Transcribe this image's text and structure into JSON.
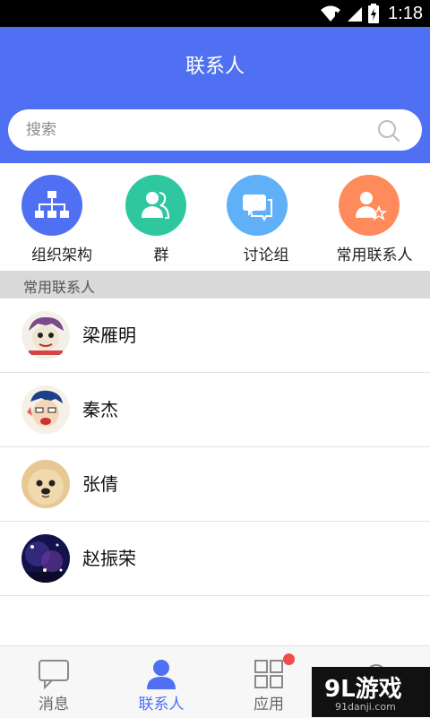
{
  "status_bar": {
    "time": "1:18"
  },
  "header": {
    "title": "联系人"
  },
  "search": {
    "placeholder": "搜索"
  },
  "quick_actions": [
    {
      "label": "组织架构",
      "icon": "org-chart-icon",
      "color": "#4f70f2"
    },
    {
      "label": "群",
      "icon": "group-icon",
      "color": "#2fc7a0"
    },
    {
      "label": "讨论组",
      "icon": "discussion-icon",
      "color": "#5fb0f7"
    },
    {
      "label": "常用联系人",
      "icon": "favorite-contact-icon",
      "color": "#ff8a5b"
    }
  ],
  "section": {
    "title": "常用联系人"
  },
  "contacts": [
    {
      "name": "梁雁明"
    },
    {
      "name": "秦杰"
    },
    {
      "name": "张倩"
    },
    {
      "name": "赵振荣"
    }
  ],
  "bottom_nav": [
    {
      "label": "消息",
      "icon": "chat-bubble-icon"
    },
    {
      "label": "联系人",
      "icon": "person-icon",
      "active": true
    },
    {
      "label": "应用",
      "icon": "apps-grid-icon",
      "badge": true
    },
    {
      "label": "",
      "icon": "settings-icon"
    }
  ],
  "watermark": {
    "main": "9L游戏",
    "sub": "91danji.com"
  },
  "colors": {
    "primary": "#4f70f2",
    "badge": "#f24b4b"
  }
}
